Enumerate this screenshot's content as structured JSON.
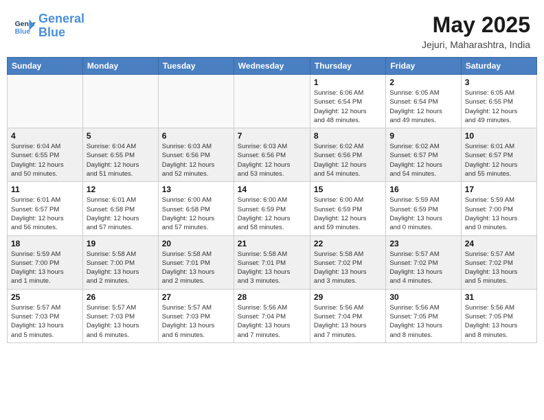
{
  "header": {
    "logo_line1": "General",
    "logo_line2": "Blue",
    "title": "May 2025",
    "subtitle": "Jejuri, Maharashtra, India"
  },
  "weekdays": [
    "Sunday",
    "Monday",
    "Tuesday",
    "Wednesday",
    "Thursday",
    "Friday",
    "Saturday"
  ],
  "weeks": [
    [
      {
        "day": "",
        "info": ""
      },
      {
        "day": "",
        "info": ""
      },
      {
        "day": "",
        "info": ""
      },
      {
        "day": "",
        "info": ""
      },
      {
        "day": "1",
        "info": "Sunrise: 6:06 AM\nSunset: 6:54 PM\nDaylight: 12 hours\nand 48 minutes."
      },
      {
        "day": "2",
        "info": "Sunrise: 6:05 AM\nSunset: 6:54 PM\nDaylight: 12 hours\nand 49 minutes."
      },
      {
        "day": "3",
        "info": "Sunrise: 6:05 AM\nSunset: 6:55 PM\nDaylight: 12 hours\nand 49 minutes."
      }
    ],
    [
      {
        "day": "4",
        "info": "Sunrise: 6:04 AM\nSunset: 6:55 PM\nDaylight: 12 hours\nand 50 minutes."
      },
      {
        "day": "5",
        "info": "Sunrise: 6:04 AM\nSunset: 6:55 PM\nDaylight: 12 hours\nand 51 minutes."
      },
      {
        "day": "6",
        "info": "Sunrise: 6:03 AM\nSunset: 6:56 PM\nDaylight: 12 hours\nand 52 minutes."
      },
      {
        "day": "7",
        "info": "Sunrise: 6:03 AM\nSunset: 6:56 PM\nDaylight: 12 hours\nand 53 minutes."
      },
      {
        "day": "8",
        "info": "Sunrise: 6:02 AM\nSunset: 6:56 PM\nDaylight: 12 hours\nand 54 minutes."
      },
      {
        "day": "9",
        "info": "Sunrise: 6:02 AM\nSunset: 6:57 PM\nDaylight: 12 hours\nand 54 minutes."
      },
      {
        "day": "10",
        "info": "Sunrise: 6:01 AM\nSunset: 6:57 PM\nDaylight: 12 hours\nand 55 minutes."
      }
    ],
    [
      {
        "day": "11",
        "info": "Sunrise: 6:01 AM\nSunset: 6:57 PM\nDaylight: 12 hours\nand 56 minutes."
      },
      {
        "day": "12",
        "info": "Sunrise: 6:01 AM\nSunset: 6:58 PM\nDaylight: 12 hours\nand 57 minutes."
      },
      {
        "day": "13",
        "info": "Sunrise: 6:00 AM\nSunset: 6:58 PM\nDaylight: 12 hours\nand 57 minutes."
      },
      {
        "day": "14",
        "info": "Sunrise: 6:00 AM\nSunset: 6:59 PM\nDaylight: 12 hours\nand 58 minutes."
      },
      {
        "day": "15",
        "info": "Sunrise: 6:00 AM\nSunset: 6:59 PM\nDaylight: 12 hours\nand 59 minutes."
      },
      {
        "day": "16",
        "info": "Sunrise: 5:59 AM\nSunset: 6:59 PM\nDaylight: 13 hours\nand 0 minutes."
      },
      {
        "day": "17",
        "info": "Sunrise: 5:59 AM\nSunset: 7:00 PM\nDaylight: 13 hours\nand 0 minutes."
      }
    ],
    [
      {
        "day": "18",
        "info": "Sunrise: 5:59 AM\nSunset: 7:00 PM\nDaylight: 13 hours\nand 1 minute."
      },
      {
        "day": "19",
        "info": "Sunrise: 5:58 AM\nSunset: 7:00 PM\nDaylight: 13 hours\nand 2 minutes."
      },
      {
        "day": "20",
        "info": "Sunrise: 5:58 AM\nSunset: 7:01 PM\nDaylight: 13 hours\nand 2 minutes."
      },
      {
        "day": "21",
        "info": "Sunrise: 5:58 AM\nSunset: 7:01 PM\nDaylight: 13 hours\nand 3 minutes."
      },
      {
        "day": "22",
        "info": "Sunrise: 5:58 AM\nSunset: 7:02 PM\nDaylight: 13 hours\nand 3 minutes."
      },
      {
        "day": "23",
        "info": "Sunrise: 5:57 AM\nSunset: 7:02 PM\nDaylight: 13 hours\nand 4 minutes."
      },
      {
        "day": "24",
        "info": "Sunrise: 5:57 AM\nSunset: 7:02 PM\nDaylight: 13 hours\nand 5 minutes."
      }
    ],
    [
      {
        "day": "25",
        "info": "Sunrise: 5:57 AM\nSunset: 7:03 PM\nDaylight: 13 hours\nand 5 minutes."
      },
      {
        "day": "26",
        "info": "Sunrise: 5:57 AM\nSunset: 7:03 PM\nDaylight: 13 hours\nand 6 minutes."
      },
      {
        "day": "27",
        "info": "Sunrise: 5:57 AM\nSunset: 7:03 PM\nDaylight: 13 hours\nand 6 minutes."
      },
      {
        "day": "28",
        "info": "Sunrise: 5:56 AM\nSunset: 7:04 PM\nDaylight: 13 hours\nand 7 minutes."
      },
      {
        "day": "29",
        "info": "Sunrise: 5:56 AM\nSunset: 7:04 PM\nDaylight: 13 hours\nand 7 minutes."
      },
      {
        "day": "30",
        "info": "Sunrise: 5:56 AM\nSunset: 7:05 PM\nDaylight: 13 hours\nand 8 minutes."
      },
      {
        "day": "31",
        "info": "Sunrise: 5:56 AM\nSunset: 7:05 PM\nDaylight: 13 hours\nand 8 minutes."
      }
    ]
  ]
}
